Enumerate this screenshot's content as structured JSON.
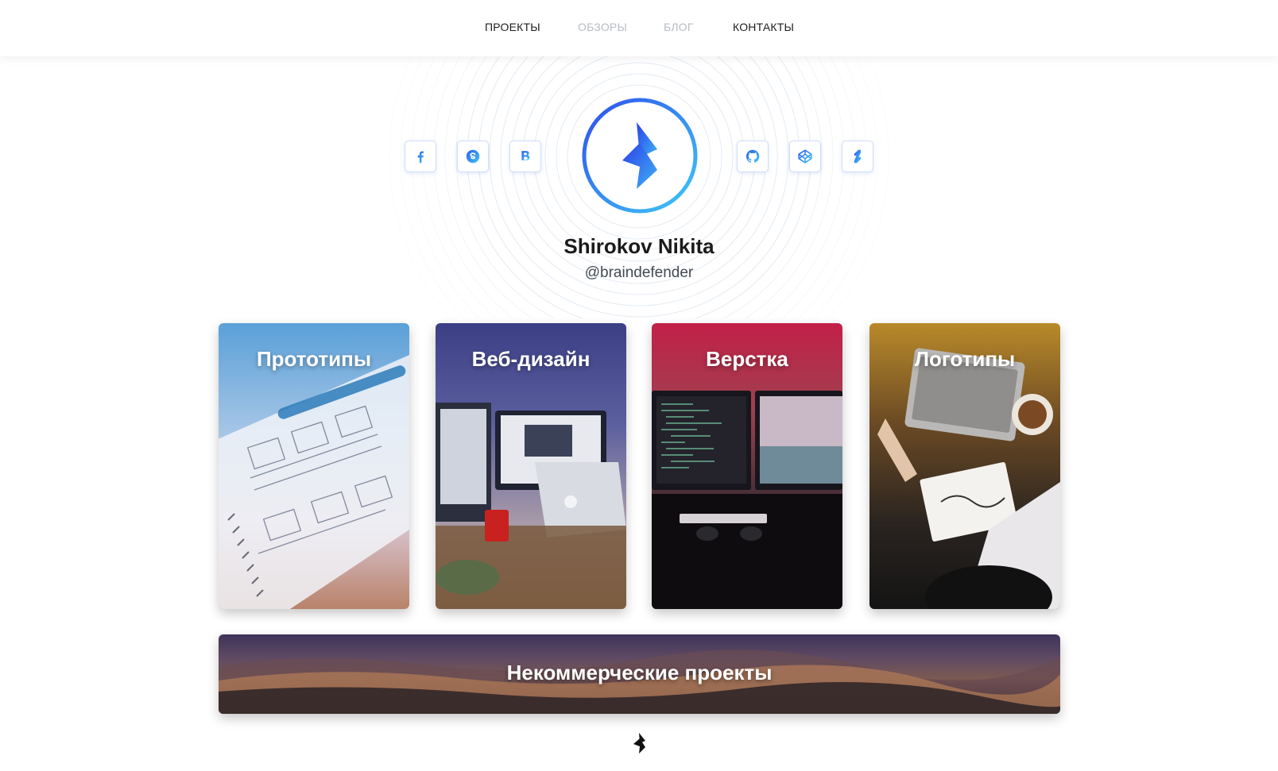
{
  "nav": {
    "items": [
      {
        "label": "ПРОЕКТЫ",
        "state": "active"
      },
      {
        "label": "ОБЗОРЫ",
        "state": "muted"
      },
      {
        "label": "БЛОГ",
        "state": "muted"
      },
      {
        "label": "КОНТАКТЫ",
        "state": "active"
      }
    ]
  },
  "profile": {
    "name": "Shirokov Nikita",
    "handle": "@braindefender",
    "avatar_icon": "bolt-logo-icon"
  },
  "social": {
    "left": [
      {
        "icon": "facebook-icon",
        "glyph": "f"
      },
      {
        "icon": "skype-icon",
        "glyph": "S"
      },
      {
        "icon": "vk-icon",
        "glyph": "B"
      }
    ],
    "right": [
      {
        "icon": "github-icon"
      },
      {
        "icon": "codepen-icon"
      },
      {
        "icon": "deviantart-icon"
      }
    ]
  },
  "cards": [
    {
      "title": "Прототипы"
    },
    {
      "title": "Веб-дизайн"
    },
    {
      "title": "Верстка"
    },
    {
      "title": "Логотипы"
    }
  ],
  "banner": {
    "title": "Некоммерческие проекты"
  },
  "colors": {
    "accent_start": "#2f5bf0",
    "accent_end": "#3fc7f5",
    "nav_active": "#1d1d1d",
    "nav_muted": "#b8bcc4"
  }
}
